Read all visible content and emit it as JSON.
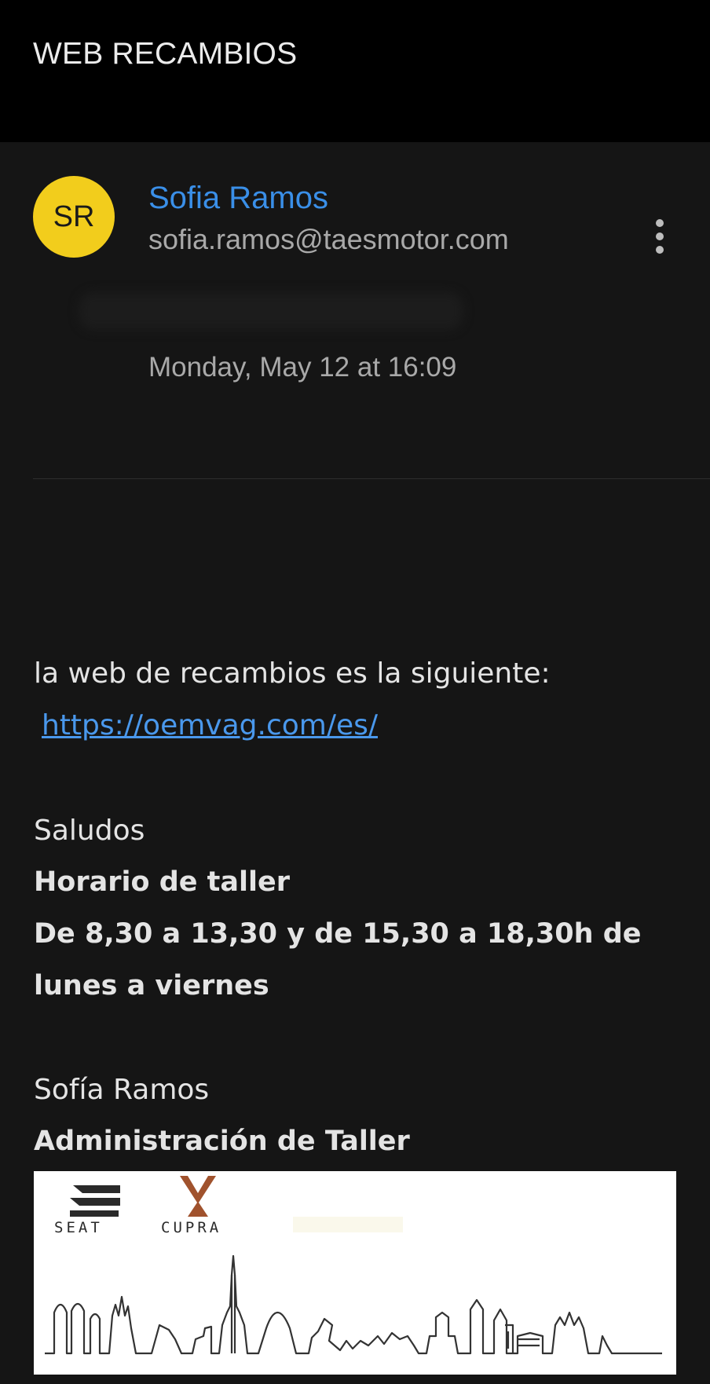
{
  "email": {
    "subject": "WEB RECAMBIOS",
    "sender": {
      "initials": "SR",
      "name": "Sofia Ramos",
      "email": "sofia.ramos@taesmotor.com"
    },
    "date": "Monday, May 12 at 16:09",
    "more_icon": "more-vertical-icon"
  },
  "body": {
    "intro": "la web de recambios es la  siguiente:",
    "link": "https://oemvag.com/es/",
    "greeting": "Saludos",
    "hours_title": "Horario de taller",
    "hours_line1": "De 8,30 a 13,30 y de 15,30 a 18,30h de",
    "hours_line2": "lunes a viernes",
    "signature_name": "Sofía Ramos",
    "signature_role": "Administración de Taller"
  },
  "signature_image": {
    "brand1": "SEAT",
    "brand2": "CUPRA"
  },
  "colors": {
    "background": "#151515",
    "topbar": "#000000",
    "avatar": "#f2cd1c",
    "accent": "#3a8fe8",
    "cupra": "#a0522d"
  }
}
